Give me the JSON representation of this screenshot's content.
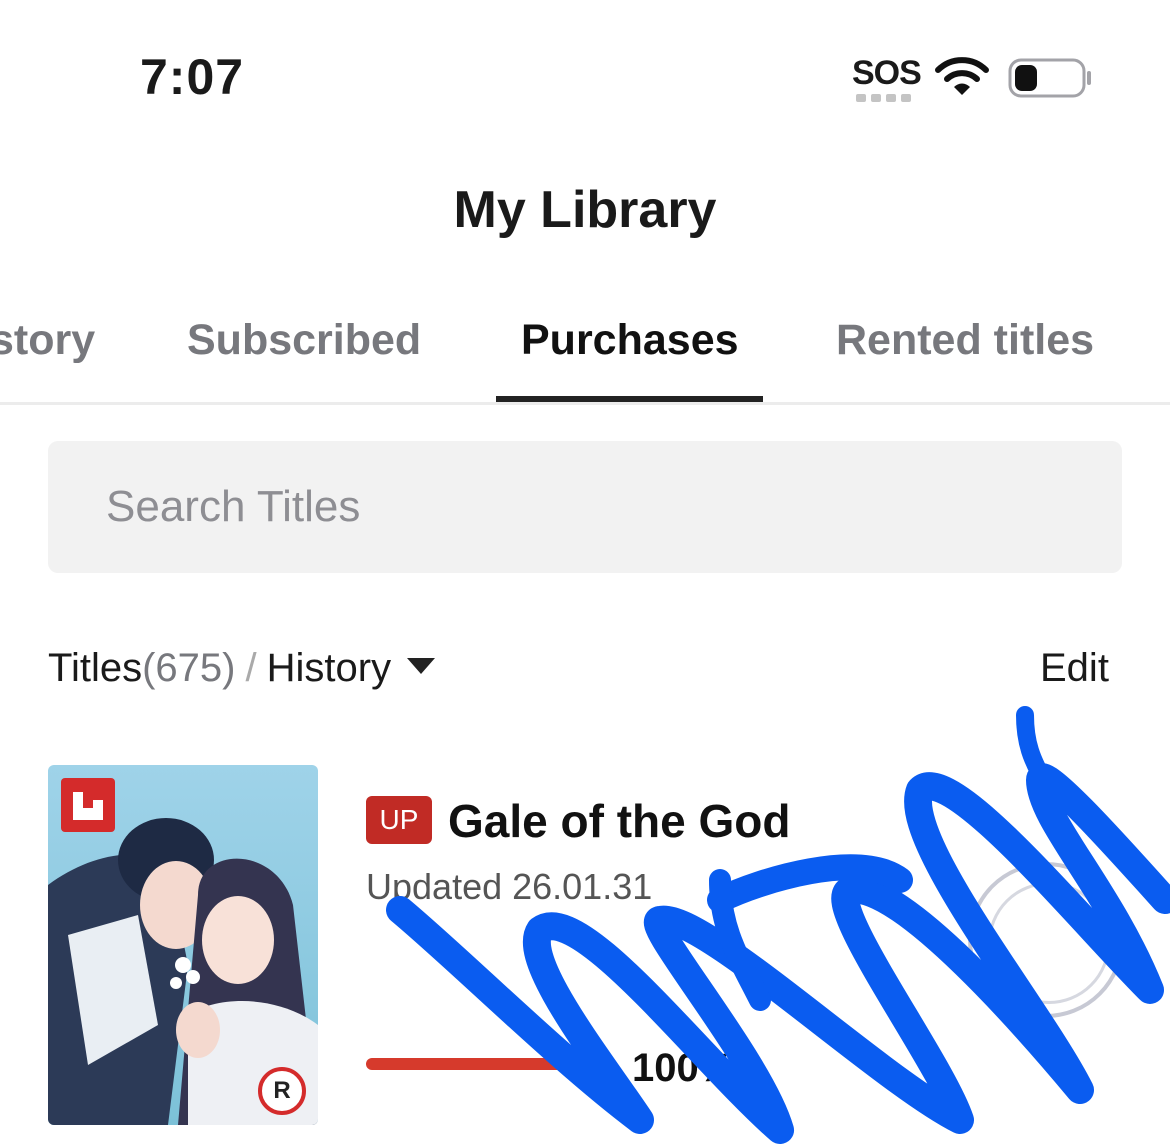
{
  "status_bar": {
    "time": "7:07",
    "carrier": "SOS",
    "icons": [
      "wifi-icon",
      "battery-icon"
    ]
  },
  "header": {
    "title": "My Library"
  },
  "tabs": [
    {
      "label": "History",
      "visible_text": "story",
      "active": false
    },
    {
      "label": "Subscribed",
      "active": false
    },
    {
      "label": "Purchases",
      "active": true
    },
    {
      "label": "Rented titles",
      "active": false
    }
  ],
  "search": {
    "placeholder": "Search Titles",
    "value": ""
  },
  "filter": {
    "count_label": "Titles",
    "count_value": "(675)",
    "separator": "/",
    "sort_label": "History",
    "edit_label": "Edit"
  },
  "items": [
    {
      "badge": "UP",
      "title": "Gale of the God",
      "updated": "Updated 26.01.31",
      "progress_label": "100%",
      "progress": 1.0,
      "rating_badge": "R"
    }
  ],
  "colors": {
    "accent_red": "#c12b25",
    "annotation_blue": "#0a5cf0",
    "tab_inactive": "#77787d"
  }
}
